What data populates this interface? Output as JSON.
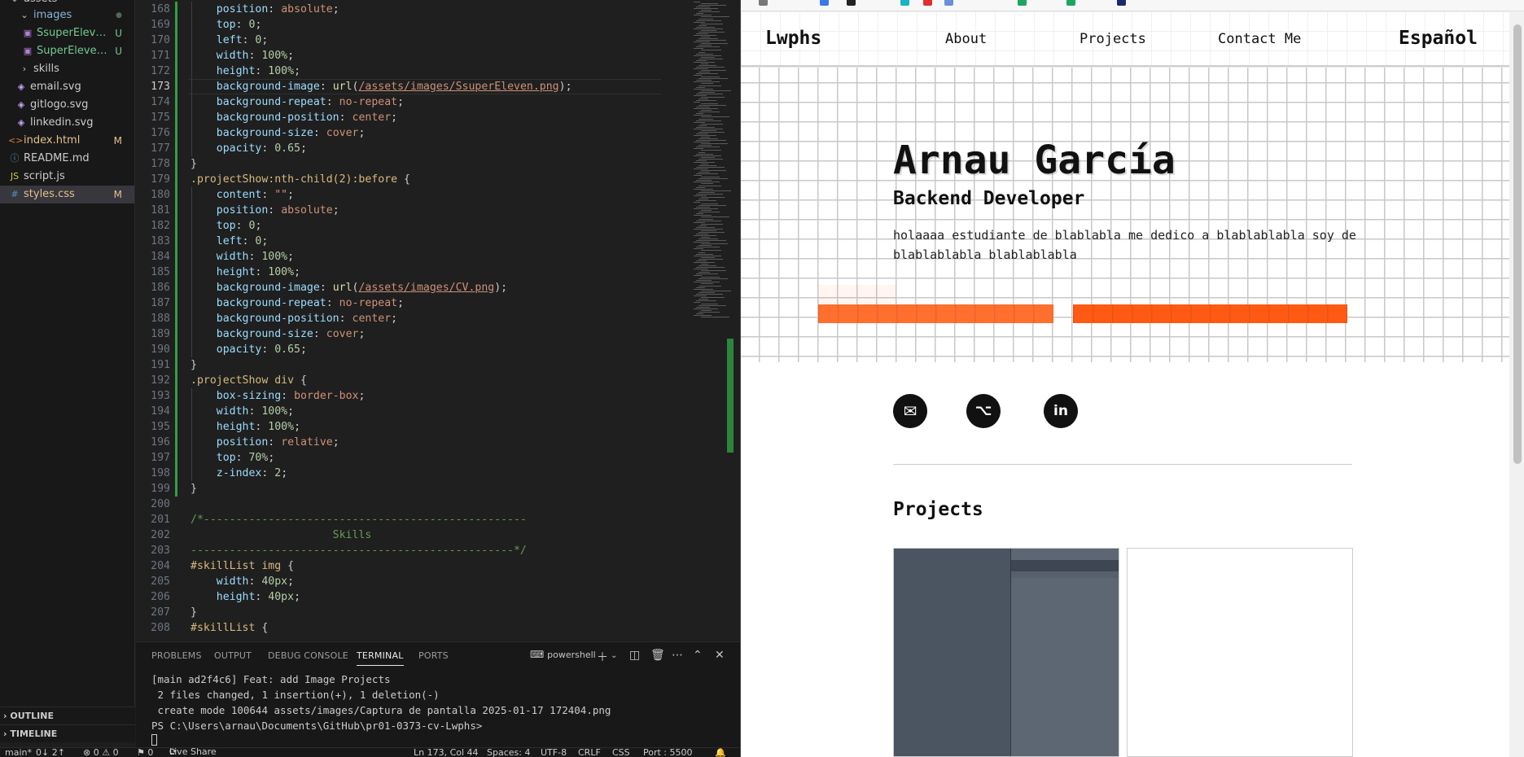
{
  "explorer": {
    "items": [
      {
        "label": "assets",
        "icon": "chevron-down-icon",
        "status": ""
      },
      {
        "label": "images",
        "icon": "chevron-down-icon",
        "status": "●"
      },
      {
        "label": "SsuperEleven....",
        "icon": "image-file-icon",
        "status": "U"
      },
      {
        "label": "SuperEleven....",
        "icon": "image-file-icon",
        "status": "U"
      },
      {
        "label": "skills",
        "icon": "chevron-right-icon",
        "status": ""
      },
      {
        "label": "email.svg",
        "icon": "svg-file-icon",
        "status": ""
      },
      {
        "label": "gitlogo.svg",
        "icon": "svg-file-icon",
        "status": ""
      },
      {
        "label": "linkedin.svg",
        "icon": "svg-file-icon",
        "status": ""
      },
      {
        "label": "index.html",
        "icon": "html-file-icon",
        "status": "M"
      },
      {
        "label": "README.md",
        "icon": "info-file-icon",
        "status": ""
      },
      {
        "label": "script.js",
        "icon": "js-file-icon",
        "status": ""
      },
      {
        "label": "styles.css",
        "icon": "css-file-icon",
        "status": "M"
      }
    ],
    "outline_label": "OUTLINE",
    "timeline_label": "TIMELINE"
  },
  "editor": {
    "current_line": 173,
    "lines": [
      {
        "n": "168",
        "t": [
          [
            "    ",
            ""
          ],
          [
            "position",
            "prop"
          ],
          [
            ": ",
            "punc"
          ],
          [
            "absolute",
            "val"
          ],
          [
            ";",
            "punc"
          ]
        ]
      },
      {
        "n": "169",
        "t": [
          [
            "    ",
            ""
          ],
          [
            "top",
            "prop"
          ],
          [
            ": ",
            "punc"
          ],
          [
            "0",
            "num-v"
          ],
          [
            ";",
            "punc"
          ]
        ]
      },
      {
        "n": "170",
        "t": [
          [
            "    ",
            ""
          ],
          [
            "left",
            "prop"
          ],
          [
            ": ",
            "punc"
          ],
          [
            "0",
            "num-v"
          ],
          [
            ";",
            "punc"
          ]
        ]
      },
      {
        "n": "171",
        "t": [
          [
            "    ",
            ""
          ],
          [
            "width",
            "prop"
          ],
          [
            ": ",
            "punc"
          ],
          [
            "100%",
            "num-v"
          ],
          [
            ";",
            "punc"
          ]
        ]
      },
      {
        "n": "172",
        "t": [
          [
            "    ",
            ""
          ],
          [
            "height",
            "prop"
          ],
          [
            ": ",
            "punc"
          ],
          [
            "100%",
            "num-v"
          ],
          [
            ";",
            "punc"
          ]
        ]
      },
      {
        "n": "173",
        "t": [
          [
            "    ",
            ""
          ],
          [
            "background-image",
            "prop"
          ],
          [
            ": ",
            "punc"
          ],
          [
            "url",
            "fn"
          ],
          [
            "(",
            "punc"
          ],
          [
            "/assets/images/SsuperEleven.png",
            "url"
          ],
          [
            ");",
            "punc"
          ]
        ]
      },
      {
        "n": "174",
        "t": [
          [
            "    ",
            ""
          ],
          [
            "background-repeat",
            "prop"
          ],
          [
            ": ",
            "punc"
          ],
          [
            "no-repeat",
            "val"
          ],
          [
            ";",
            "punc"
          ]
        ]
      },
      {
        "n": "175",
        "t": [
          [
            "    ",
            ""
          ],
          [
            "background-position",
            "prop"
          ],
          [
            ": ",
            "punc"
          ],
          [
            "center",
            "val"
          ],
          [
            ";",
            "punc"
          ]
        ]
      },
      {
        "n": "176",
        "t": [
          [
            "    ",
            ""
          ],
          [
            "background-size",
            "prop"
          ],
          [
            ": ",
            "punc"
          ],
          [
            "cover",
            "val"
          ],
          [
            ";",
            "punc"
          ]
        ]
      },
      {
        "n": "177",
        "t": [
          [
            "    ",
            ""
          ],
          [
            "opacity",
            "prop"
          ],
          [
            ": ",
            "punc"
          ],
          [
            "0.65",
            "num-v"
          ],
          [
            ";",
            "punc"
          ]
        ]
      },
      {
        "n": "178",
        "t": [
          [
            "}",
            "punc"
          ]
        ]
      },
      {
        "n": "179",
        "t": [
          [
            ".projectShow:nth-child(2):before",
            "sel"
          ],
          [
            " {",
            "punc"
          ]
        ]
      },
      {
        "n": "180",
        "t": [
          [
            "    ",
            ""
          ],
          [
            "content",
            "prop"
          ],
          [
            ": ",
            "punc"
          ],
          [
            "\"\"",
            "str"
          ],
          [
            ";",
            "punc"
          ]
        ]
      },
      {
        "n": "181",
        "t": [
          [
            "    ",
            ""
          ],
          [
            "position",
            "prop"
          ],
          [
            ": ",
            "punc"
          ],
          [
            "absolute",
            "val"
          ],
          [
            ";",
            "punc"
          ]
        ]
      },
      {
        "n": "182",
        "t": [
          [
            "    ",
            ""
          ],
          [
            "top",
            "prop"
          ],
          [
            ": ",
            "punc"
          ],
          [
            "0",
            "num-v"
          ],
          [
            ";",
            "punc"
          ]
        ]
      },
      {
        "n": "183",
        "t": [
          [
            "    ",
            ""
          ],
          [
            "left",
            "prop"
          ],
          [
            ": ",
            "punc"
          ],
          [
            "0",
            "num-v"
          ],
          [
            ";",
            "punc"
          ]
        ]
      },
      {
        "n": "184",
        "t": [
          [
            "    ",
            ""
          ],
          [
            "width",
            "prop"
          ],
          [
            ": ",
            "punc"
          ],
          [
            "100%",
            "num-v"
          ],
          [
            ";",
            "punc"
          ]
        ]
      },
      {
        "n": "185",
        "t": [
          [
            "    ",
            ""
          ],
          [
            "height",
            "prop"
          ],
          [
            ": ",
            "punc"
          ],
          [
            "100%",
            "num-v"
          ],
          [
            ";",
            "punc"
          ]
        ]
      },
      {
        "n": "186",
        "t": [
          [
            "    ",
            ""
          ],
          [
            "background-image",
            "prop"
          ],
          [
            ": ",
            "punc"
          ],
          [
            "url",
            "fn"
          ],
          [
            "(",
            "punc"
          ],
          [
            "/assets/images/CV.png",
            "url"
          ],
          [
            ");",
            "punc"
          ]
        ]
      },
      {
        "n": "187",
        "t": [
          [
            "    ",
            ""
          ],
          [
            "background-repeat",
            "prop"
          ],
          [
            ": ",
            "punc"
          ],
          [
            "no-repeat",
            "val"
          ],
          [
            ";",
            "punc"
          ]
        ]
      },
      {
        "n": "188",
        "t": [
          [
            "    ",
            ""
          ],
          [
            "background-position",
            "prop"
          ],
          [
            ": ",
            "punc"
          ],
          [
            "center",
            "val"
          ],
          [
            ";",
            "punc"
          ]
        ]
      },
      {
        "n": "189",
        "t": [
          [
            "    ",
            ""
          ],
          [
            "background-size",
            "prop"
          ],
          [
            ": ",
            "punc"
          ],
          [
            "cover",
            "val"
          ],
          [
            ";",
            "punc"
          ]
        ]
      },
      {
        "n": "190",
        "t": [
          [
            "    ",
            ""
          ],
          [
            "opacity",
            "prop"
          ],
          [
            ": ",
            "punc"
          ],
          [
            "0.65",
            "num-v"
          ],
          [
            ";",
            "punc"
          ]
        ]
      },
      {
        "n": "191",
        "t": [
          [
            "}",
            "punc"
          ]
        ]
      },
      {
        "n": "192",
        "t": [
          [
            ".projectShow div",
            "sel"
          ],
          [
            " {",
            "punc"
          ]
        ]
      },
      {
        "n": "193",
        "t": [
          [
            "    ",
            ""
          ],
          [
            "box-sizing",
            "prop"
          ],
          [
            ": ",
            "punc"
          ],
          [
            "border-box",
            "val"
          ],
          [
            ";",
            "punc"
          ]
        ]
      },
      {
        "n": "194",
        "t": [
          [
            "    ",
            ""
          ],
          [
            "width",
            "prop"
          ],
          [
            ": ",
            "punc"
          ],
          [
            "100%",
            "num-v"
          ],
          [
            ";",
            "punc"
          ]
        ]
      },
      {
        "n": "195",
        "t": [
          [
            "    ",
            ""
          ],
          [
            "height",
            "prop"
          ],
          [
            ": ",
            "punc"
          ],
          [
            "100%",
            "num-v"
          ],
          [
            ";",
            "punc"
          ]
        ]
      },
      {
        "n": "196",
        "t": [
          [
            "    ",
            ""
          ],
          [
            "position",
            "prop"
          ],
          [
            ": ",
            "punc"
          ],
          [
            "relative",
            "val"
          ],
          [
            ";",
            "punc"
          ]
        ]
      },
      {
        "n": "197",
        "t": [
          [
            "    ",
            ""
          ],
          [
            "top",
            "prop"
          ],
          [
            ": ",
            "punc"
          ],
          [
            "70%",
            "num-v"
          ],
          [
            ";",
            "punc"
          ]
        ]
      },
      {
        "n": "198",
        "t": [
          [
            "    ",
            ""
          ],
          [
            "z-index",
            "prop"
          ],
          [
            ": ",
            "punc"
          ],
          [
            "2",
            "num-v"
          ],
          [
            ";",
            "punc"
          ]
        ]
      },
      {
        "n": "199",
        "t": [
          [
            "}",
            "punc"
          ]
        ]
      },
      {
        "n": "200",
        "t": []
      },
      {
        "n": "201",
        "t": [
          [
            "/*--------------------------------------------------",
            "cmt"
          ]
        ]
      },
      {
        "n": "202",
        "t": [
          [
            "                      Skills",
            "cmt"
          ]
        ]
      },
      {
        "n": "203",
        "t": [
          [
            "--------------------------------------------------*/",
            "cmt"
          ]
        ]
      },
      {
        "n": "204",
        "t": [
          [
            "#skillList img",
            "sel"
          ],
          [
            " {",
            "punc"
          ]
        ]
      },
      {
        "n": "205",
        "t": [
          [
            "    ",
            ""
          ],
          [
            "width",
            "prop"
          ],
          [
            ": ",
            "punc"
          ],
          [
            "40px",
            "num-v"
          ],
          [
            ";",
            "punc"
          ]
        ]
      },
      {
        "n": "206",
        "t": [
          [
            "    ",
            ""
          ],
          [
            "height",
            "prop"
          ],
          [
            ": ",
            "punc"
          ],
          [
            "40px",
            "num-v"
          ],
          [
            ";",
            "punc"
          ]
        ]
      },
      {
        "n": "207",
        "t": [
          [
            "}",
            "punc"
          ]
        ]
      },
      {
        "n": "208",
        "t": [
          [
            "#skillList",
            "sel"
          ],
          [
            " {",
            "punc"
          ]
        ]
      }
    ]
  },
  "panel": {
    "tabs": [
      "PROBLEMS",
      "OUTPUT",
      "DEBUG CONSOLE",
      "TERMINAL",
      "PORTS"
    ],
    "active_tab": "TERMINAL",
    "shell": "powershell",
    "terminal_lines": [
      "[main ad2f4c6] Feat: add Image Projects",
      " 2 files changed, 1 insertion(+), 1 deletion(-)",
      " create mode 100644 assets/images/Captura de pantalla 2025-01-17 172404.png",
      "PS C:\\Users\\arnau\\Documents\\GitHub\\pr01-0373-cv-Lwphs>"
    ]
  },
  "status_bar": {
    "branch": "main*",
    "sync": "0↓ 2↑",
    "problems": "⊗ 0 ⚠ 0",
    "ports": "⚑ 0",
    "live_share": "Live Share",
    "position": "Ln 173, Col 44",
    "spaces": "Spaces: 4",
    "encoding": "UTF-8",
    "eol": "CRLF",
    "language": "CSS",
    "port": "Port : 5500"
  },
  "site": {
    "logo": "Lwphs",
    "nav": [
      "About",
      "Projects",
      "Contact Me"
    ],
    "lang": "Español",
    "name": "Arnau García",
    "role": "Backend Developer",
    "description": "holaaaa estudiante de blablabla me dedico a blablablabla soy de blablablabla blablablabla",
    "accent": "#ff5a14",
    "socials": [
      "email-icon",
      "github-icon",
      "linkedin-icon"
    ],
    "projects_title": "Projects"
  }
}
